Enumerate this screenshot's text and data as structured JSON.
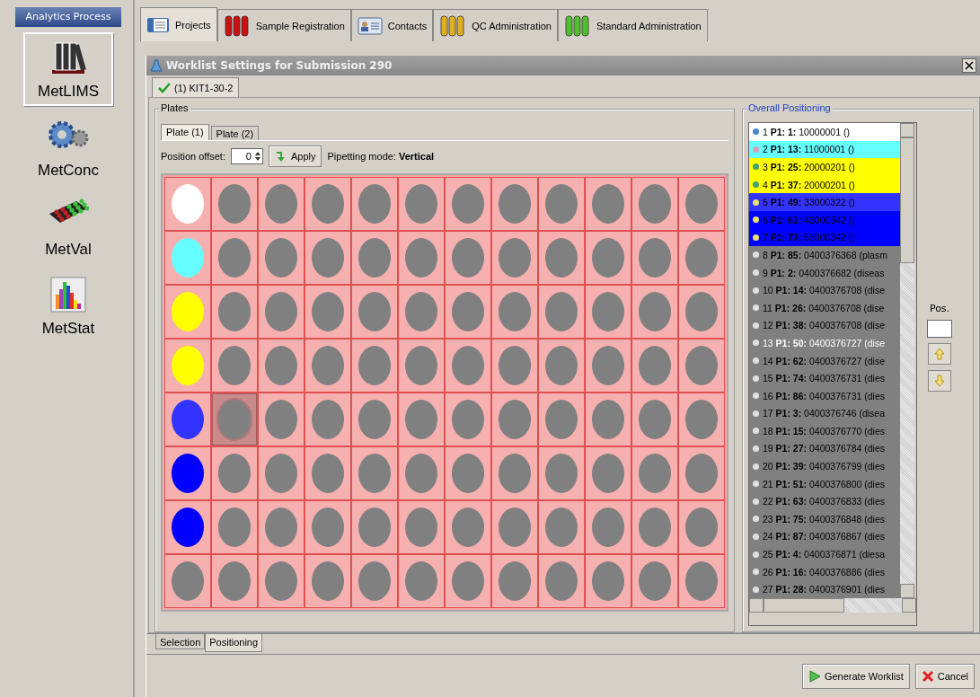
{
  "sidebar": {
    "title": "Analytics Process",
    "items": [
      {
        "label": "MetLIMS",
        "selected": true
      },
      {
        "label": "MetConc",
        "selected": false
      },
      {
        "label": "MetVal",
        "selected": false
      },
      {
        "label": "MetStat",
        "selected": false
      }
    ]
  },
  "tabs": [
    {
      "label": "Projects",
      "selected": true
    },
    {
      "label": "Sample Registration",
      "selected": false
    },
    {
      "label": "Contacts",
      "selected": false
    },
    {
      "label": "QC Administration",
      "selected": false
    },
    {
      "label": "Standard Administration",
      "selected": false
    }
  ],
  "dialog": {
    "title": "Worklist Settings for Submission 290",
    "kit_tabs": [
      {
        "label": "(1) KIT1-30-2",
        "selected": true,
        "checked": true
      }
    ],
    "plates": {
      "title": "Plates",
      "tabs": [
        {
          "label": "Plate (1)",
          "selected": true
        },
        {
          "label": "Plate (2)",
          "selected": false
        }
      ],
      "offset_label": "Position offset:",
      "offset_value": "0",
      "apply": "Apply",
      "pipetting": "Pipetting mode: **Vertical**",
      "rows": [
        {
          "wells": [
            {
              "color": "#ffffff",
              "selected": false
            },
            {
              "color": "#808080",
              "selected": false
            },
            {
              "color": "#808080",
              "selected": false
            },
            {
              "color": "#808080",
              "selected": false
            },
            {
              "color": "#808080",
              "selected": false
            },
            {
              "color": "#808080",
              "selected": false
            },
            {
              "color": "#808080",
              "selected": false
            },
            {
              "color": "#808080",
              "selected": false
            },
            {
              "color": "#808080",
              "selected": false
            },
            {
              "color": "#808080",
              "selected": false
            },
            {
              "color": "#808080",
              "selected": false
            },
            {
              "color": "#808080",
              "selected": false
            }
          ]
        },
        {
          "wells": [
            {
              "color": "#66ffff",
              "selected": false
            },
            {
              "color": "#808080",
              "selected": false
            },
            {
              "color": "#808080",
              "selected": false
            },
            {
              "color": "#808080",
              "selected": false
            },
            {
              "color": "#808080",
              "selected": false
            },
            {
              "color": "#808080",
              "selected": false
            },
            {
              "color": "#808080",
              "selected": false
            },
            {
              "color": "#808080",
              "selected": false
            },
            {
              "color": "#808080",
              "selected": false
            },
            {
              "color": "#808080",
              "selected": false
            },
            {
              "color": "#808080",
              "selected": false
            },
            {
              "color": "#808080",
              "selected": false
            }
          ]
        },
        {
          "wells": [
            {
              "color": "#ffff00",
              "selected": false
            },
            {
              "color": "#808080",
              "selected": false
            },
            {
              "color": "#808080",
              "selected": false
            },
            {
              "color": "#808080",
              "selected": false
            },
            {
              "color": "#808080",
              "selected": false
            },
            {
              "color": "#808080",
              "selected": false
            },
            {
              "color": "#808080",
              "selected": false
            },
            {
              "color": "#808080",
              "selected": false
            },
            {
              "color": "#808080",
              "selected": false
            },
            {
              "color": "#808080",
              "selected": false
            },
            {
              "color": "#808080",
              "selected": false
            },
            {
              "color": "#808080",
              "selected": false
            }
          ]
        },
        {
          "wells": [
            {
              "color": "#ffff00",
              "selected": false
            },
            {
              "color": "#808080",
              "selected": false
            },
            {
              "color": "#808080",
              "selected": false
            },
            {
              "color": "#808080",
              "selected": false
            },
            {
              "color": "#808080",
              "selected": false
            },
            {
              "color": "#808080",
              "selected": false
            },
            {
              "color": "#808080",
              "selected": false
            },
            {
              "color": "#808080",
              "selected": false
            },
            {
              "color": "#808080",
              "selected": false
            },
            {
              "color": "#808080",
              "selected": false
            },
            {
              "color": "#808080",
              "selected": false
            },
            {
              "color": "#808080",
              "selected": false
            }
          ]
        },
        {
          "wells": [
            {
              "color": "#3333ff",
              "selected": false
            },
            {
              "color": "#808080",
              "selected": true
            },
            {
              "color": "#808080",
              "selected": false
            },
            {
              "color": "#808080",
              "selected": false
            },
            {
              "color": "#808080",
              "selected": false
            },
            {
              "color": "#808080",
              "selected": false
            },
            {
              "color": "#808080",
              "selected": false
            },
            {
              "color": "#808080",
              "selected": false
            },
            {
              "color": "#808080",
              "selected": false
            },
            {
              "color": "#808080",
              "selected": false
            },
            {
              "color": "#808080",
              "selected": false
            },
            {
              "color": "#808080",
              "selected": false
            }
          ]
        },
        {
          "wells": [
            {
              "color": "#0000ff",
              "selected": false
            },
            {
              "color": "#808080",
              "selected": false
            },
            {
              "color": "#808080",
              "selected": false
            },
            {
              "color": "#808080",
              "selected": false
            },
            {
              "color": "#808080",
              "selected": false
            },
            {
              "color": "#808080",
              "selected": false
            },
            {
              "color": "#808080",
              "selected": false
            },
            {
              "color": "#808080",
              "selected": false
            },
            {
              "color": "#808080",
              "selected": false
            },
            {
              "color": "#808080",
              "selected": false
            },
            {
              "color": "#808080",
              "selected": false
            },
            {
              "color": "#808080",
              "selected": false
            }
          ]
        },
        {
          "wells": [
            {
              "color": "#0000ff",
              "selected": false
            },
            {
              "color": "#808080",
              "selected": false
            },
            {
              "color": "#808080",
              "selected": false
            },
            {
              "color": "#808080",
              "selected": false
            },
            {
              "color": "#808080",
              "selected": false
            },
            {
              "color": "#808080",
              "selected": false
            },
            {
              "color": "#808080",
              "selected": false
            },
            {
              "color": "#808080",
              "selected": false
            },
            {
              "color": "#808080",
              "selected": false
            },
            {
              "color": "#808080",
              "selected": false
            },
            {
              "color": "#808080",
              "selected": false
            },
            {
              "color": "#808080",
              "selected": false
            }
          ]
        },
        {
          "wells": [
            {
              "color": "#808080",
              "selected": false
            },
            {
              "color": "#808080",
              "selected": false
            },
            {
              "color": "#808080",
              "selected": false
            },
            {
              "color": "#808080",
              "selected": false
            },
            {
              "color": "#808080",
              "selected": false
            },
            {
              "color": "#808080",
              "selected": false
            },
            {
              "color": "#808080",
              "selected": false
            },
            {
              "color": "#808080",
              "selected": false
            },
            {
              "color": "#808080",
              "selected": false
            },
            {
              "color": "#808080",
              "selected": false
            },
            {
              "color": "#808080",
              "selected": false
            },
            {
              "color": "#808080",
              "selected": false
            }
          ]
        }
      ]
    },
    "positioning": {
      "title": "Overall Positioning",
      "pos_label": "Pos.",
      "items": [
        {
          "text": "1 **P1: 1:** 10000001 ()",
          "color": "#ffffff",
          "dot": {
            "color": "#4a86c8"
          },
          "selected": false
        },
        {
          "text": "2 **P1: 13:** 11000001 ()",
          "color": "#66ffff",
          "dot": {
            "color": "#d8a0b8"
          },
          "selected": false
        },
        {
          "text": "3 **P1: 25:** 20000201 ()",
          "color": "#ffff00",
          "dot": {
            "color": "#40a070"
          },
          "selected": false
        },
        {
          "text": "4 **P1: 37:** 20000201 ()",
          "color": "#ffff00",
          "dot": {
            "color": "#40a070"
          },
          "selected": false
        },
        {
          "text": "5 **P1: 49:** 33000322 ()",
          "color": "#3333ff",
          "dot": {
            "color": "#e8e070"
          },
          "selected": false
        },
        {
          "text": "6 **P1: 61:** 43000342 ()",
          "color": "#0000ff",
          "dot": {
            "color": "#e8e070"
          },
          "selected": false
        },
        {
          "text": "7 **P1: 73:** 53000342 ()",
          "color": "#0000ff",
          "dot": {
            "color": "#e8e070"
          },
          "selected": false
        },
        {
          "text": "8 **P1: 85:** 0400376368 (plasm",
          "color": "#808080",
          "dot": {
            "color": "#e0e0e0"
          },
          "selected": false
        },
        {
          "text": "9 **P1: 2:** 0400376682 (diseas",
          "color": "#808080",
          "dot": {
            "color": "#e0e0e0"
          },
          "selected": false
        },
        {
          "text": "10 **P1: 14:** 0400376708 (dise",
          "color": "#808080",
          "dot": {
            "color": "#e0e0e0"
          },
          "selected": false
        },
        {
          "text": "11 **P1: 26:** 0400376708 (dise",
          "color": "#808080",
          "dot": {
            "color": "#e0e0e0"
          },
          "selected": false
        },
        {
          "text": "12 **P1: 38:** 0400376708 (dise",
          "color": "#808080",
          "dot": {
            "color": "#e0e0e0"
          },
          "selected": false
        },
        {
          "text": "13 **P1: 50:** 0400376727 (dise",
          "color": "#808080",
          "dot": {
            "color": "#e0e0e0"
          },
          "selected": true
        },
        {
          "text": "14 **P1: 62:** 0400376727 (dise",
          "color": "#808080",
          "dot": {
            "color": "#e0e0e0"
          },
          "selected": false
        },
        {
          "text": "15 **P1: 74:** 0400376731 (dies",
          "color": "#808080",
          "dot": {
            "color": "#e0e0e0"
          },
          "selected": false
        },
        {
          "text": "16 **P1: 86:** 0400376731 (dies",
          "color": "#808080",
          "dot": {
            "color": "#e0e0e0"
          },
          "selected": false
        },
        {
          "text": "17 **P1: 3:** 0400376746 (disea",
          "color": "#808080",
          "dot": {
            "color": "#e0e0e0"
          },
          "selected": false
        },
        {
          "text": "18 **P1: 15:** 0400376770 (dies",
          "color": "#808080",
          "dot": {
            "color": "#e0e0e0"
          },
          "selected": false
        },
        {
          "text": "19 **P1: 27:** 0400376784 (dies",
          "color": "#808080",
          "dot": {
            "color": "#e0e0e0"
          },
          "selected": false
        },
        {
          "text": "20 **P1: 39:** 0400376799 (dies",
          "color": "#808080",
          "dot": {
            "color": "#e0e0e0"
          },
          "selected": false
        },
        {
          "text": "21 **P1: 51:** 0400376800 (dies",
          "color": "#808080",
          "dot": {
            "color": "#e0e0e0"
          },
          "selected": false
        },
        {
          "text": "22 **P1: 63:** 0400376833 (dies",
          "color": "#808080",
          "dot": {
            "color": "#e0e0e0"
          },
          "selected": false
        },
        {
          "text": "23 **P1: 75:** 0400376848 (dies",
          "color": "#808080",
          "dot": {
            "color": "#e0e0e0"
          },
          "selected": false
        },
        {
          "text": "24 **P1: 87:** 0400376867 (dies",
          "color": "#808080",
          "dot": {
            "color": "#e0e0e0"
          },
          "selected": false
        },
        {
          "text": "25 **P1: 4:** 0400376871 (diesa",
          "color": "#808080",
          "dot": {
            "color": "#e0e0e0"
          },
          "selected": false
        },
        {
          "text": "26 **P1: 16:** 0400376886 (dies",
          "color": "#808080",
          "dot": {
            "color": "#e0e0e0"
          },
          "selected": false
        },
        {
          "text": "27 **P1: 28:** 0400376901 (dies",
          "color": "#808080",
          "dot": {
            "color": "#e0e0e0"
          },
          "selected": false
        }
      ]
    },
    "bottom_tabs": [
      {
        "label": "Selection",
        "selected": false
      },
      {
        "label": "Positioning",
        "selected": true
      }
    ],
    "buttons": [
      {
        "kind": "generate",
        "label": "Generate Worklist"
      },
      {
        "kind": "cancel",
        "label": "Cancel"
      }
    ]
  }
}
